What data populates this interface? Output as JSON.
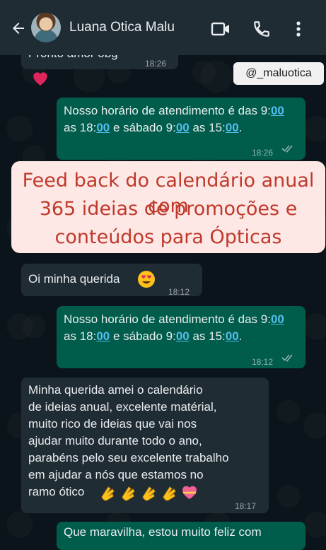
{
  "header": {
    "contact_name": "Luana Otica Malu",
    "icons": [
      "back-arrow-icon",
      "video-call-icon",
      "phone-call-icon",
      "more-options-icon"
    ]
  },
  "messages": [
    {
      "id": "m0",
      "direction": "in",
      "text": "Pronto amor obg",
      "time": "18:26"
    },
    {
      "id": "m0b",
      "direction": "in",
      "emoji": "heart"
    },
    {
      "id": "m1",
      "direction": "out",
      "text_parts": [
        "Nosso horário de atendimento é das 9:",
        "00",
        " as 18:",
        "00",
        " e sábado 9:",
        "00",
        " as 15:",
        "00",
        "."
      ],
      "time": "18:26",
      "status": "read"
    },
    {
      "id": "m2",
      "direction": "out",
      "time": "",
      "status": "read"
    },
    {
      "id": "m3",
      "direction": "in",
      "text": "Oi minha querida",
      "emoji": "heart-eyes",
      "time": "18:12"
    },
    {
      "id": "m4",
      "direction": "out",
      "text_parts": [
        "Nosso horário de atendimento é das 9:",
        "00",
        " as 18:",
        "00",
        " e sábado 9:",
        "00",
        " as 15:",
        "00",
        "."
      ],
      "time": "18:12",
      "status": "read"
    },
    {
      "id": "m5",
      "direction": "in",
      "text": "Minha querida amei o calendário\nde ideias anual, excelente matérial,\nmuito  rico de ideias que vai nos\najudar muito durante todo o ano,\nparabéns pelo seu excelente trabalho\nem ajudar a nós que estamos no\nramo ótico",
      "emoji": "clapping-hands x4, heart-with-ribbon",
      "time": "18:17"
    },
    {
      "id": "m6",
      "direction": "out",
      "text": "Que maravilha, estou muito feliz com"
    }
  ],
  "overlay": {
    "handle": "@_maluotica",
    "banner_lines": [
      "Feed back do calendário anual com",
      "365 ideias de promoções e",
      "conteúdos para Ópticas"
    ]
  },
  "colors": {
    "header_bg": "#1f2c34",
    "chat_bg": "#0b141a",
    "incoming_bubble": "#202c33",
    "outgoing_bubble": "#005c4b",
    "link": "#53bdeb",
    "banner_bg": "#fde8e6",
    "banner_text": "#c0392b"
  }
}
